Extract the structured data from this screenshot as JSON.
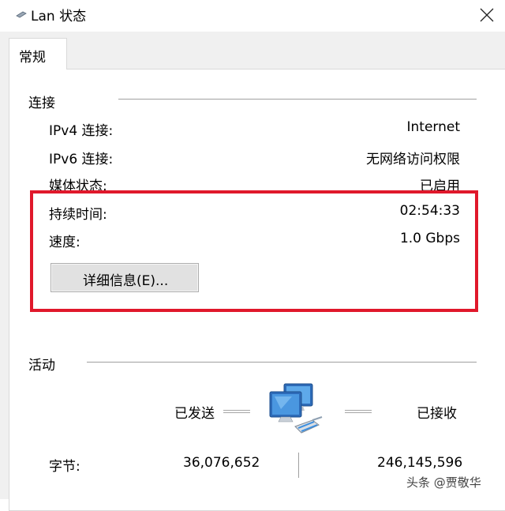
{
  "window": {
    "title": "Lan 状态"
  },
  "tabs": [
    {
      "label": "常规"
    }
  ],
  "connection": {
    "group_label": "连接",
    "rows": [
      {
        "label": "IPv4 连接:",
        "value": "Internet"
      },
      {
        "label": "IPv6 连接:",
        "value": "无网络访问权限"
      },
      {
        "label": "媒体状态:",
        "value": "已启用"
      },
      {
        "label": "持续时间:",
        "value": "02:54:33"
      },
      {
        "label": "速度:",
        "value": "1.0 Gbps"
      }
    ],
    "details_button": "详细信息(E)..."
  },
  "activity": {
    "group_label": "活动",
    "sent_label": "已发送",
    "received_label": "已接收",
    "bytes_label": "字节:",
    "bytes_sent": "36,076,652",
    "bytes_received": "246,145,596"
  },
  "watermark": "头条 @贾敬华",
  "colors": {
    "highlight": "#e0182b",
    "dialog_bg": "#f0f0f0",
    "panel_bg": "#ffffff"
  },
  "icons": {
    "title": "network-adapter-icon",
    "activity": "network-computers-icon",
    "close": "close-icon"
  }
}
